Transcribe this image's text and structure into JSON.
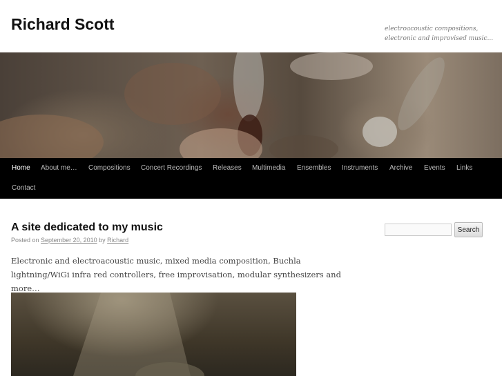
{
  "site": {
    "title": "Richard Scott",
    "description": "electroacoustic compositions, electronic and improvised music..."
  },
  "nav": {
    "items": [
      {
        "label": "Home"
      },
      {
        "label": "About me…"
      },
      {
        "label": "Compositions"
      },
      {
        "label": "Concert Recordings"
      },
      {
        "label": "Releases"
      },
      {
        "label": "Multimedia"
      },
      {
        "label": "Ensembles"
      },
      {
        "label": "Instruments"
      },
      {
        "label": "Archive"
      },
      {
        "label": "Events"
      },
      {
        "label": "Links"
      },
      {
        "label": "Contact"
      }
    ],
    "current": "Home"
  },
  "post": {
    "title": "A site dedicated to my music",
    "meta_prefix": "Posted on",
    "date": "September 20, 2010",
    "meta_by": "by",
    "author": "Richard",
    "content": "Electronic and electroacoustic music, mixed media composition, Buchla lightning/WiGi infra red controllers, free improvisation, modular synthesizers and more…"
  },
  "sidebar": {
    "search_value": "",
    "search_button": "Search"
  }
}
